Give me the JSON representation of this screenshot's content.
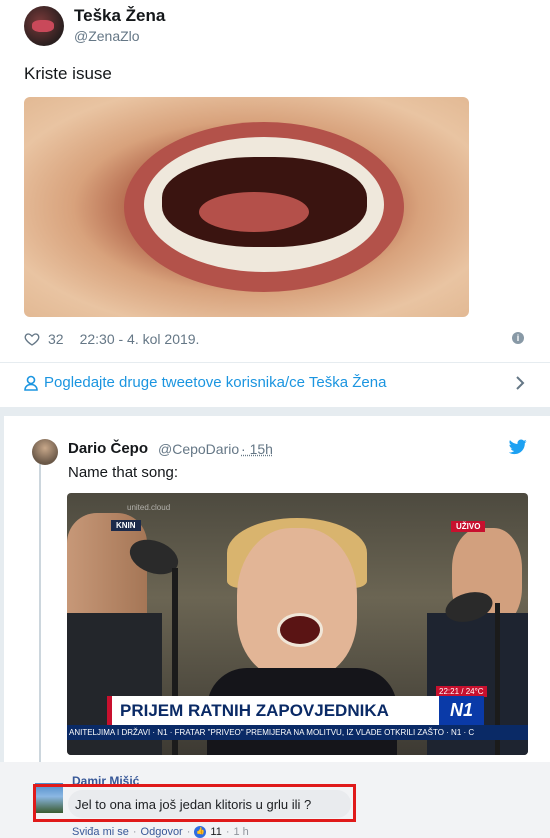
{
  "tweet": {
    "author_name": "Teška Žena",
    "author_handle": "@ZenaZlo",
    "text": "Kriste isuse",
    "likes": "32",
    "timestamp": "22:30 - 4. kol 2019.",
    "more_link": "Pogledajte druge tweetove korisnika/ce Teška Žena"
  },
  "quoted_tweet": {
    "author_name": "Dario Čepo",
    "author_handle": "@CepoDario",
    "time": "15h",
    "text": "Name that song:",
    "image_overlay": {
      "watermark": "united.cloud",
      "location": "KNIN",
      "live": "UŽIVO",
      "clock": "22:21 / 24°C",
      "headline": "PRIJEM RATNIH ZAPOVJEDNIKA",
      "channel": "N1",
      "ticker": "ANITELJIMA I DRŽAVI · N1 · FRATAR \"PRIVEO\" PREMIJERA NA MOLITVU, IZ VLADE OTKRILI ZAŠTO · N1 · C"
    }
  },
  "facebook_comment": {
    "author": "Damir Mišić",
    "text": "Jel to ona ima još jedan klitoris u grlu ili ?",
    "like_action": "Sviđa mi se",
    "reply_action": "Odgovor",
    "reaction_count": "11",
    "time": "1 h"
  },
  "colors": {
    "link_blue": "#1b95e0",
    "fb_blue": "#385898",
    "highlight_red": "#e01a1a"
  }
}
